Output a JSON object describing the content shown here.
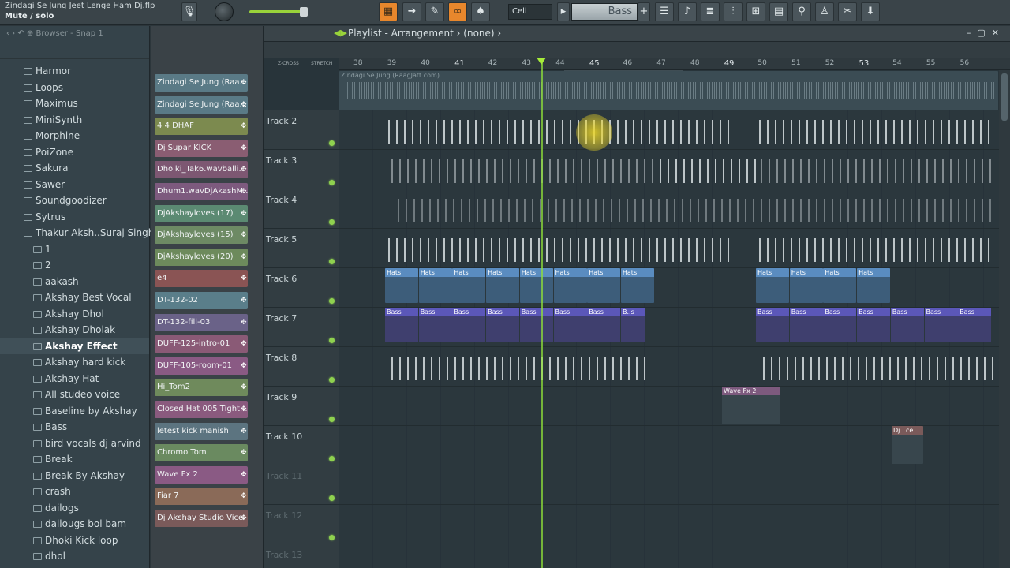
{
  "app": {
    "title": "Zindagi Se Jung Jeet Lenge Ham Dj.flp",
    "hint": "Mute / solo",
    "snap": "Cell",
    "pattern": "Bass"
  },
  "browser": {
    "header": "Browser - Snap 1",
    "items": [
      {
        "label": "Harmor",
        "indent": 1
      },
      {
        "label": "Loops",
        "indent": 1
      },
      {
        "label": "Maximus",
        "indent": 1
      },
      {
        "label": "MiniSynth",
        "indent": 1
      },
      {
        "label": "Morphine",
        "indent": 1
      },
      {
        "label": "PoiZone",
        "indent": 1
      },
      {
        "label": "Sakura",
        "indent": 1
      },
      {
        "label": "Sawer",
        "indent": 1
      },
      {
        "label": "Soundgoodizer",
        "indent": 1
      },
      {
        "label": "Sytrus",
        "indent": 1
      },
      {
        "label": "Thakur Aksh..Suraj Singh)",
        "indent": 1,
        "open": true
      },
      {
        "label": "1",
        "indent": 2
      },
      {
        "label": "2",
        "indent": 2
      },
      {
        "label": "aakash",
        "indent": 2
      },
      {
        "label": "Akshay Best Vocal",
        "indent": 2
      },
      {
        "label": "Akshay Dhol",
        "indent": 2
      },
      {
        "label": "Akshay Dholak",
        "indent": 2
      },
      {
        "label": "Akshay Effect",
        "indent": 2,
        "selected": true
      },
      {
        "label": "Akshay hard kick",
        "indent": 2
      },
      {
        "label": "Akshay Hat",
        "indent": 2
      },
      {
        "label": "All studeo voice",
        "indent": 2
      },
      {
        "label": "Baseline by Akshay",
        "indent": 2
      },
      {
        "label": "Bass",
        "indent": 2
      },
      {
        "label": "bird vocals dj arvind",
        "indent": 2
      },
      {
        "label": "Break",
        "indent": 2
      },
      {
        "label": "Break By Akshay",
        "indent": 2
      },
      {
        "label": "crash",
        "indent": 2
      },
      {
        "label": "dailogs",
        "indent": 2
      },
      {
        "label": "dailougs bol bam",
        "indent": 2
      },
      {
        "label": "Dhoki Kick loop",
        "indent": 2
      },
      {
        "label": "dhol",
        "indent": 2
      }
    ]
  },
  "channels": [
    {
      "label": "Zindagi Se Jung (Raa...",
      "color": "#5a7a86"
    },
    {
      "label": "Zindagi Se Jung (Raa...",
      "color": "#5a7a86"
    },
    {
      "label": "4 4 DHAF",
      "color": "#7c8a4f"
    },
    {
      "label": "Dj Supar KICK",
      "color": "#8a5d72"
    },
    {
      "label": "Dholki_Tak6.wavballi...",
      "color": "#7d5772"
    },
    {
      "label": "Dhum1.wavDjAkashM...",
      "color": "#7d5a7e"
    },
    {
      "label": "DjAkshayloves (17)",
      "color": "#5b8a72"
    },
    {
      "label": "DjAkshayloves (15)",
      "color": "#6d8a64"
    },
    {
      "label": "DjAkshayloves (20)",
      "color": "#6d8a5c"
    },
    {
      "label": "e4",
      "color": "#8a5454"
    },
    {
      "label": "DT-132-02",
      "color": "#5a7e8a"
    },
    {
      "label": "DT-132-fill-03",
      "color": "#6a6288"
    },
    {
      "label": "DUFF-125-intro-01",
      "color": "#8a5a76"
    },
    {
      "label": "DUFF-105-room-01",
      "color": "#8a5a84"
    },
    {
      "label": "Hi_Tom2",
      "color": "#6f8a5c"
    },
    {
      "label": "Closed Hat 005 Tight...",
      "color": "#8a5a7e"
    },
    {
      "label": "letest kick manish",
      "color": "#5c7480"
    },
    {
      "label": "Chromo Tom",
      "color": "#6a8a60"
    },
    {
      "label": "Wave Fx 2",
      "color": "#8a5a84"
    },
    {
      "label": "Fiar 7",
      "color": "#8a6a58"
    },
    {
      "label": "Dj Akshay Studio Vice",
      "color": "#7a5a5a"
    }
  ],
  "playlist": {
    "title": "Playlist - Arrangement",
    "breadcrumb": "(none)",
    "zcross": "Z-CROSS",
    "stretch": "STRETCH",
    "bars": [
      "38",
      "39",
      "40",
      "41",
      "42",
      "43",
      "44",
      "45",
      "46",
      "47",
      "48",
      "49",
      "50",
      "51",
      "52",
      "53",
      "54",
      "55",
      "56"
    ],
    "ghost_clip_label": "Zindagi Se Jung (RaagJatt.com)",
    "tracks": [
      "Track 2",
      "Track 3",
      "Track 4",
      "Track 5",
      "Track 6",
      "Track 7",
      "Track 8",
      "Track 9",
      "Track 10",
      "Track 11",
      "Track 12",
      "Track 13"
    ],
    "hats_label": "Hats",
    "bass_label": "Bass",
    "bass_short": "B..s",
    "wavefx_label": "Wave Fx 2",
    "djce_label": "Dj...ce"
  }
}
